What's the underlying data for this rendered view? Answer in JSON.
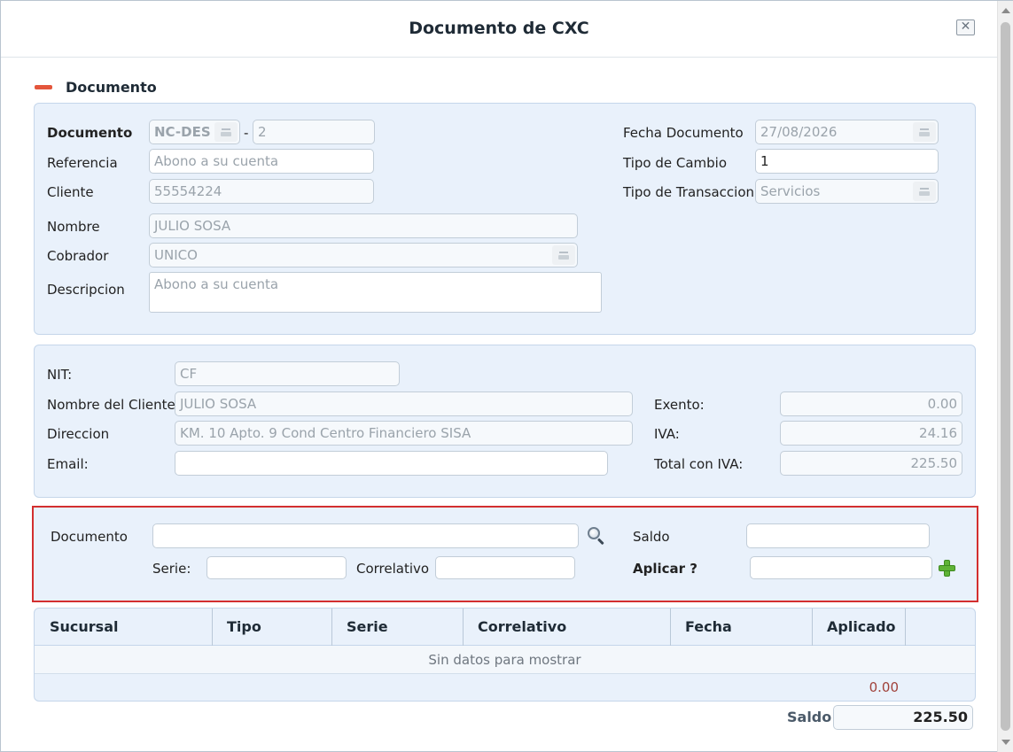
{
  "window": {
    "title": "Documento de CXC",
    "close_glyph": "✕"
  },
  "section": {
    "title": "Documento"
  },
  "doc_panel": {
    "documento_label": "Documento",
    "doc_prefix": "NC-DES",
    "separator": "-",
    "doc_number": "2",
    "referencia_label": "Referencia",
    "referencia_value": "Abono a su cuenta",
    "cliente_label": "Cliente",
    "cliente_value": "55554224",
    "nombre_label": "Nombre",
    "nombre_value": "JULIO SOSA",
    "cobrador_label": "Cobrador",
    "cobrador_value": "UNICO",
    "descripcion_label": "Descripcion",
    "descripcion_value": "Abono a su cuenta",
    "fecha_label": "Fecha Documento",
    "fecha_value": "27/08/2026",
    "tipo_cambio_label": "Tipo de Cambio",
    "tipo_cambio_value": "1",
    "tipo_trans_label": "Tipo de Transaccion",
    "tipo_trans_value": "Servicios"
  },
  "client_panel": {
    "nit_label": "NIT:",
    "nit_value": "CF",
    "nombre_cliente_label": "Nombre del Cliente",
    "nombre_cliente_value": "JULIO SOSA",
    "direccion_label": "Direccion",
    "direccion_value": "KM. 10 Apto. 9 Cond Centro Financiero SISA",
    "email_label": "Email:",
    "email_value": "",
    "exento_label": "Exento:",
    "exento_value": "0.00",
    "iva_label": "IVA:",
    "iva_value": "24.16",
    "total_label": "Total con IVA:",
    "total_value": "225.50"
  },
  "apply_panel": {
    "documento_label": "Documento",
    "documento_value": "",
    "serie_label": "Serie:",
    "serie_value": "",
    "correlativo_label": "Correlativo",
    "correlativo_value": "",
    "saldo_label": "Saldo",
    "saldo_value": "",
    "aplicar_label": "Aplicar ?",
    "aplicar_value": ""
  },
  "grid": {
    "columns": [
      "Sucursal",
      "Tipo",
      "Serie",
      "Correlativo",
      "Fecha",
      "Aplicado"
    ],
    "empty_text": "Sin datos para mostrar",
    "total": "0.00"
  },
  "footer": {
    "saldo_label": "Saldo",
    "saldo_value": "225.50"
  },
  "colors": {
    "accent_red": "#d32f2f",
    "panel_bg": "#e9f1fb",
    "add_green": "#5fb336"
  }
}
